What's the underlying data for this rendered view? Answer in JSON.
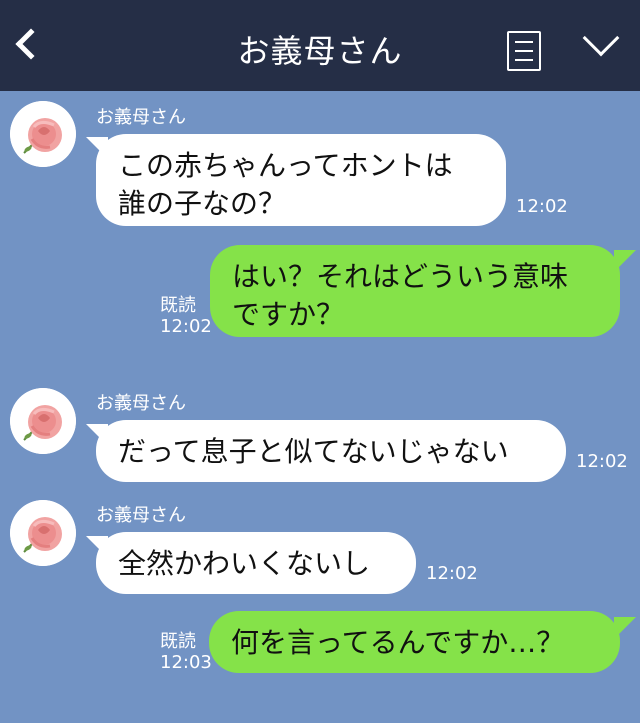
{
  "header": {
    "title": "お義母さん",
    "back_icon": "chevron-left-icon",
    "menu_icon": "menu-icon",
    "expand_icon": "chevron-down-icon"
  },
  "colors": {
    "header_bg": "#252e46",
    "chat_bg": "#7293c4",
    "incoming_bubble": "#ffffff",
    "outgoing_bubble": "#85e249"
  },
  "messages": [
    {
      "sender": "お義母さん",
      "direction": "incoming",
      "lines": [
        "この赤ちゃんってホントは",
        "誰の子なの？"
      ],
      "time": "12:02"
    },
    {
      "direction": "outgoing",
      "lines": [
        "はい？それはどういう意味",
        "ですか？"
      ],
      "read": "既読",
      "time": "12:02"
    },
    {
      "sender": "お義母さん",
      "direction": "incoming",
      "lines": [
        "だって息子と似てないじゃない"
      ],
      "time": "12:02"
    },
    {
      "sender": "お義母さん",
      "direction": "incoming",
      "lines": [
        "全然かわいくないし"
      ],
      "time": "12:02"
    },
    {
      "direction": "outgoing",
      "lines": [
        "何を言ってるんですか…？"
      ],
      "read": "既読",
      "time": "12:03"
    }
  ]
}
